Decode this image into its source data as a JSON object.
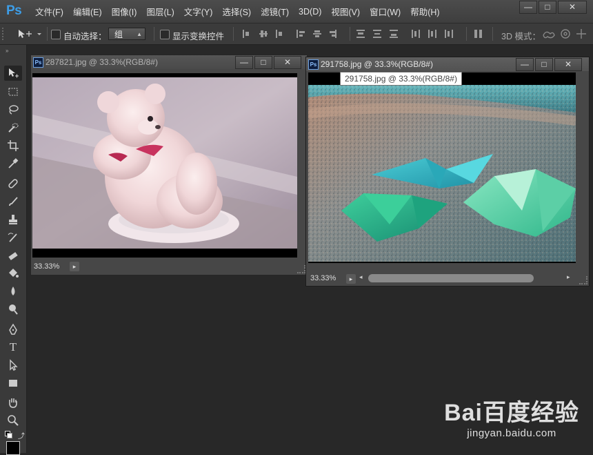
{
  "app": {
    "logo": "Ps"
  },
  "menu": {
    "items": [
      "文件(F)",
      "编辑(E)",
      "图像(I)",
      "图层(L)",
      "文字(Y)",
      "选择(S)",
      "滤镜(T)",
      "3D(D)",
      "视图(V)",
      "窗口(W)",
      "帮助(H)"
    ]
  },
  "window_controls": {
    "minimize": "—",
    "restore": "□",
    "close": "✕"
  },
  "options": {
    "auto_select_label": "自动选择：",
    "auto_select_value": "组",
    "show_transform_label": "显示变换控件",
    "mode_3d_label": "3D 模式："
  },
  "documents": [
    {
      "title": "287821.jpg @ 33.3%(RGB/8#)",
      "zoom": "33.33%",
      "active": false
    },
    {
      "title": "291758.jpg @ 33.3%(RGB/8#)",
      "zoom": "33.33%",
      "active": true,
      "tooltip": "291758.jpg @ 33.3%(RGB/8#)"
    }
  ],
  "watermark": {
    "brand": "Bai百度经验",
    "url": "jingyan.baidu.com"
  },
  "colors": {
    "background": "#282828",
    "panel": "#3b3b3b",
    "ps_blue": "#3d9ee8"
  }
}
